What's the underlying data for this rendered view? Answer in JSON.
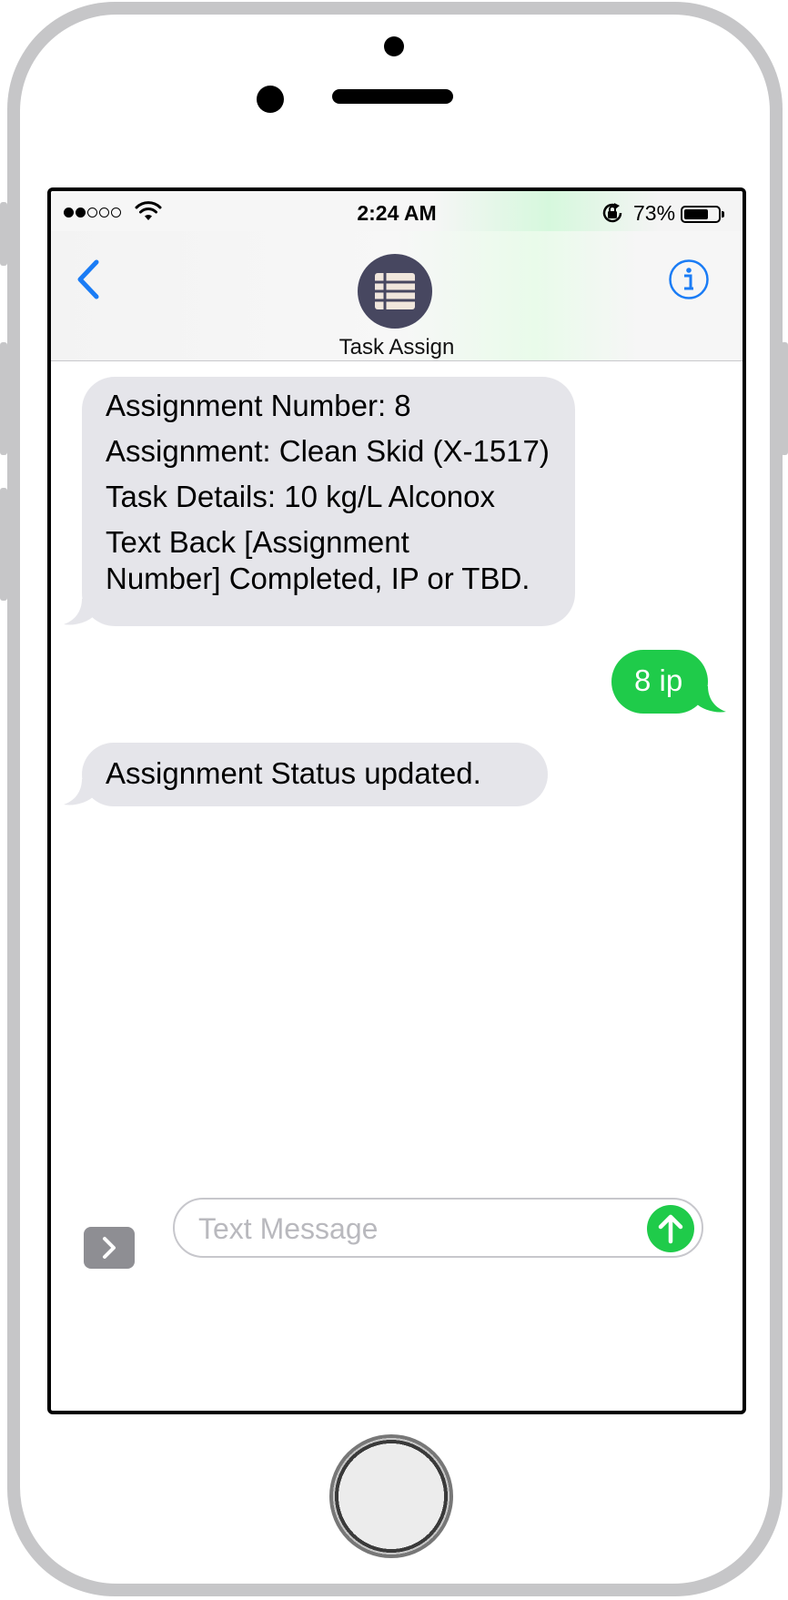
{
  "status_bar": {
    "signal_bars_filled": 2,
    "signal_bars_total": 5,
    "time": "2:24 AM",
    "battery_text": "73%",
    "battery_level": 0.73,
    "icons": [
      "wifi-icon",
      "rotation-lock-icon",
      "battery-icon"
    ]
  },
  "header": {
    "contact_name": "Task Assign",
    "avatar_icon": "list-icon",
    "back_icon": "chevron-left-icon",
    "info_icon": "info-icon"
  },
  "messages": [
    {
      "direction": "incoming",
      "lines": [
        "Assignment Number: 8",
        "Assignment: Clean Skid (X-1517)",
        "Task Details: 10 kg/L Alconox",
        "Text Back [Assignment",
        "Number] Completed, IP or TBD."
      ]
    },
    {
      "direction": "outgoing",
      "lines": [
        "8 ip"
      ]
    },
    {
      "direction": "incoming",
      "lines": [
        "Assignment Status updated."
      ]
    }
  ],
  "composer": {
    "placeholder": "Text Message",
    "value": "",
    "apps_icon": "chevron-right-icon",
    "send_icon": "arrow-up-icon"
  },
  "colors": {
    "incoming_bubble": "#e5e5ea",
    "outgoing_bubble": "#1fcb4a",
    "accent_blue": "#1a7cf5",
    "avatar_bg": "#474760"
  }
}
